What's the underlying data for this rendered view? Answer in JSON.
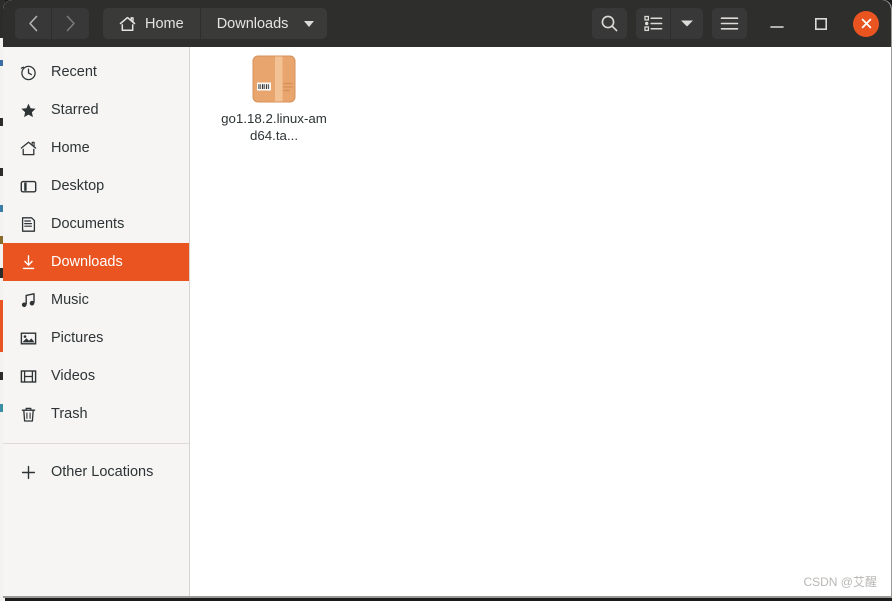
{
  "window": {
    "titlebar": {
      "nav": [
        {
          "name": "back",
          "icon": "chevron-left-icon",
          "enabled": true
        },
        {
          "name": "forward",
          "icon": "chevron-right-icon",
          "enabled": false
        }
      ],
      "breadcrumb": [
        {
          "label": "Home",
          "icon": "home-icon",
          "has_dropdown": false
        },
        {
          "label": "Downloads",
          "icon": "",
          "has_dropdown": true
        }
      ],
      "tools": [
        {
          "name": "search",
          "icon": "search-icon"
        },
        {
          "name": "view-list",
          "icon": "list-view-icon"
        },
        {
          "name": "view-options",
          "icon": "chevron-down-icon"
        },
        {
          "name": "main-menu",
          "icon": "hamburger-menu-icon"
        }
      ],
      "controls": [
        {
          "name": "minimize",
          "icon": "minimize-icon"
        },
        {
          "name": "maximize",
          "icon": "maximize-icon"
        },
        {
          "name": "close",
          "icon": "close-icon"
        }
      ]
    },
    "sidebar": {
      "items": [
        {
          "label": "Recent",
          "icon": "clock-icon",
          "selected": false
        },
        {
          "label": "Starred",
          "icon": "star-icon",
          "selected": false
        },
        {
          "label": "Home",
          "icon": "home-icon",
          "selected": false
        },
        {
          "label": "Desktop",
          "icon": "desktop-icon",
          "selected": false
        },
        {
          "label": "Documents",
          "icon": "document-icon",
          "selected": false
        },
        {
          "label": "Downloads",
          "icon": "download-icon",
          "selected": true
        },
        {
          "label": "Music",
          "icon": "music-icon",
          "selected": false
        },
        {
          "label": "Pictures",
          "icon": "picture-icon",
          "selected": false
        },
        {
          "label": "Videos",
          "icon": "video-icon",
          "selected": false
        },
        {
          "label": "Trash",
          "icon": "trash-icon",
          "selected": false
        }
      ],
      "other_locations": {
        "label": "Other Locations",
        "icon": "plus-icon"
      }
    },
    "content": {
      "files": [
        {
          "name": "go1.18.2.linux-amd64.ta...",
          "icon": "archive-package-icon",
          "selected": false
        }
      ]
    },
    "watermark": "CSDN @艾醒"
  },
  "colors": {
    "titlebar_bg": "#2e2e2d",
    "button_bg": "#383838",
    "sidebar_bg": "#f6f5f4",
    "accent_orange": "#e95420",
    "content_bg": "#ffffff",
    "text_dark": "#2e3436",
    "text_light": "#e6e4e1",
    "archive_icon": "#e8a56e"
  }
}
